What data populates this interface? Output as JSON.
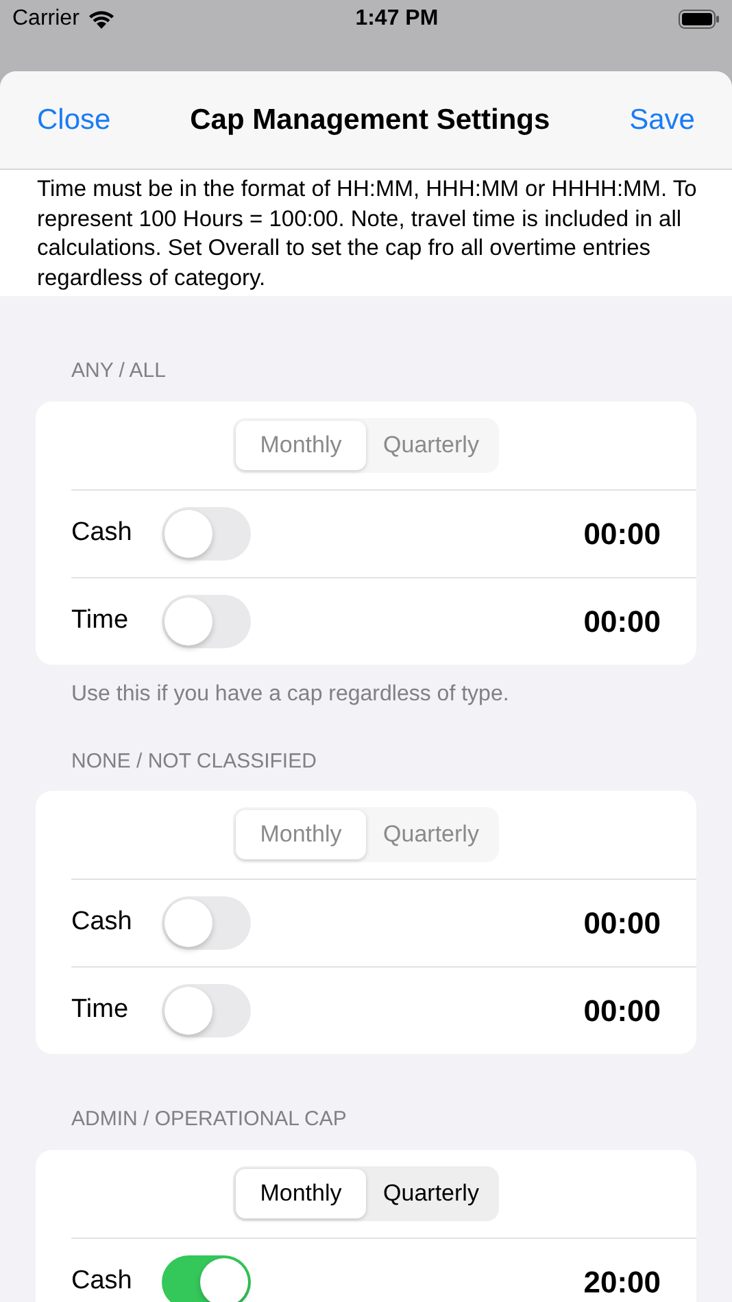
{
  "status_bar": {
    "carrier": "Carrier",
    "time": "1:47 PM"
  },
  "sheet": {
    "close": "Close",
    "title": "Cap Management Settings",
    "save": "Save"
  },
  "description": "Time must be in the format of HH:MM, HHH:MM or HHHH:MM. To represent 100 Hours = 100:00. Note, travel time is included in all calculations. Set Overall to set the cap fro all overtime entries regardless of category.",
  "sections": [
    {
      "header": "ANY / ALL",
      "segments": {
        "disabled": true,
        "options": [
          {
            "label": "Monthly",
            "selected": true
          },
          {
            "label": "Quarterly",
            "selected": false
          }
        ]
      },
      "rows": [
        {
          "label": "Cash",
          "on": false,
          "value": "00:00"
        },
        {
          "label": "Time",
          "on": false,
          "value": "00:00"
        }
      ],
      "footer": "Use this if you have a cap regardless of type."
    },
    {
      "header": "NONE / NOT CLASSIFIED",
      "segments": {
        "disabled": true,
        "options": [
          {
            "label": "Monthly",
            "selected": true
          },
          {
            "label": "Quarterly",
            "selected": false
          }
        ]
      },
      "rows": [
        {
          "label": "Cash",
          "on": false,
          "value": "00:00"
        },
        {
          "label": "Time",
          "on": false,
          "value": "00:00"
        }
      ]
    },
    {
      "header": "ADMIN / OPERATIONAL CAP",
      "segments": {
        "disabled": false,
        "options": [
          {
            "label": "Monthly",
            "selected": true
          },
          {
            "label": "Quarterly",
            "selected": false
          }
        ]
      },
      "rows": [
        {
          "label": "Cash",
          "on": true,
          "value": "20:00"
        }
      ]
    }
  ]
}
